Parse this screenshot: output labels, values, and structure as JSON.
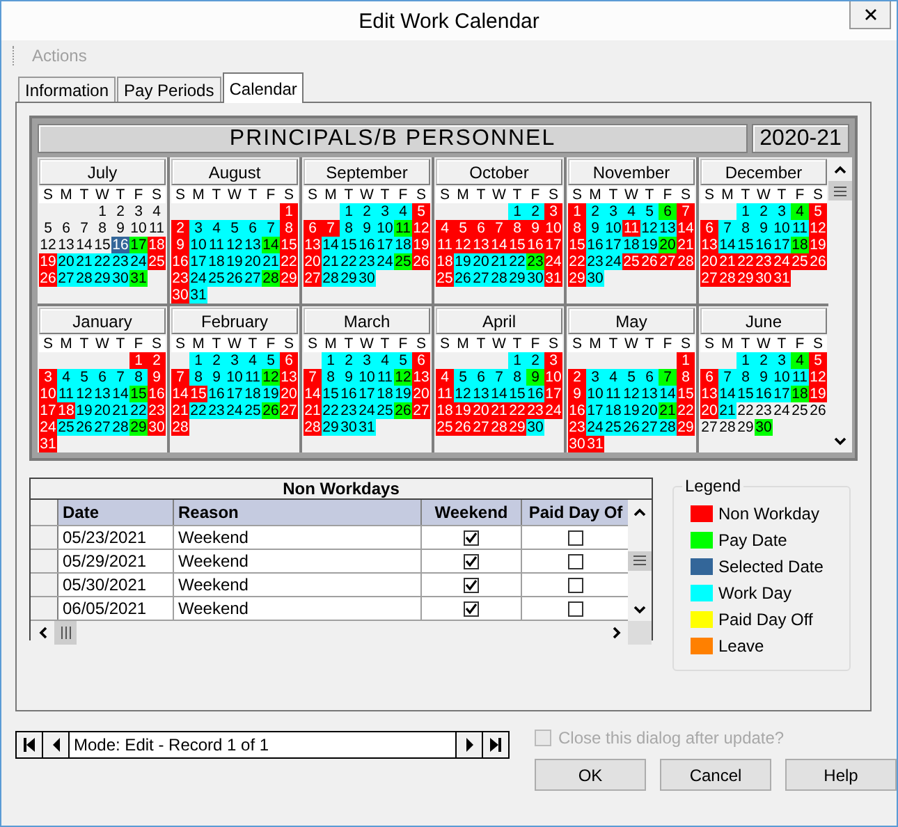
{
  "window": {
    "title": "Edit Work Calendar"
  },
  "menu": [
    {
      "label": "Actions",
      "disabled": true
    }
  ],
  "tabs": [
    {
      "label": "Information",
      "selected": false
    },
    {
      "label": "Pay Periods",
      "selected": false
    },
    {
      "label": "Calendar",
      "selected": true
    }
  ],
  "calendar": {
    "title": "PRINCIPALS/B PERSONNEL",
    "year": "2020-21",
    "months": [
      {
        "name": "July",
        "weekdays": [
          "S",
          "M",
          "T",
          "W",
          "T",
          "F",
          "S"
        ],
        "days": [
          {
            "day": "1",
            "kind": "none"
          },
          {
            "day": "2",
            "kind": "none"
          },
          {
            "day": "3",
            "kind": "none"
          },
          {
            "day": "4",
            "kind": "none"
          },
          {
            "day": "5",
            "kind": "none"
          },
          {
            "day": "6",
            "kind": "none"
          },
          {
            "day": "7",
            "kind": "none"
          },
          {
            "day": "8",
            "kind": "none"
          },
          {
            "day": "9",
            "kind": "none"
          },
          {
            "day": "10",
            "kind": "none"
          },
          {
            "day": "11",
            "kind": "none"
          },
          {
            "day": "12",
            "kind": "none"
          },
          {
            "day": "13",
            "kind": "none"
          },
          {
            "day": "14",
            "kind": "none"
          },
          {
            "day": "15",
            "kind": "none"
          },
          {
            "day": "16",
            "kind": "selected"
          },
          {
            "day": "17",
            "kind": "pay"
          },
          {
            "day": "18",
            "kind": "off"
          },
          {
            "day": "19",
            "kind": "off"
          },
          {
            "day": "20",
            "kind": "work"
          },
          {
            "day": "21",
            "kind": "work"
          },
          {
            "day": "22",
            "kind": "work"
          },
          {
            "day": "23",
            "kind": "work"
          },
          {
            "day": "24",
            "kind": "work"
          },
          {
            "day": "25",
            "kind": "off"
          },
          {
            "day": "26",
            "kind": "off"
          },
          {
            "day": "27",
            "kind": "work"
          },
          {
            "day": "28",
            "kind": "work"
          },
          {
            "day": "29",
            "kind": "work"
          },
          {
            "day": "30",
            "kind": "work"
          },
          {
            "day": "31",
            "kind": "pay"
          }
        ]
      },
      {
        "name": "August",
        "weekdays": [
          "S",
          "M",
          "T",
          "W",
          "T",
          "F",
          "S"
        ],
        "days": [
          {
            "day": "1",
            "kind": "off"
          },
          {
            "day": "2",
            "kind": "off"
          },
          {
            "day": "3",
            "kind": "work"
          },
          {
            "day": "4",
            "kind": "work"
          },
          {
            "day": "5",
            "kind": "work"
          },
          {
            "day": "6",
            "kind": "work"
          },
          {
            "day": "7",
            "kind": "work"
          },
          {
            "day": "8",
            "kind": "off"
          },
          {
            "day": "9",
            "kind": "off"
          },
          {
            "day": "10",
            "kind": "work"
          },
          {
            "day": "11",
            "kind": "work"
          },
          {
            "day": "12",
            "kind": "work"
          },
          {
            "day": "13",
            "kind": "work"
          },
          {
            "day": "14",
            "kind": "pay"
          },
          {
            "day": "15",
            "kind": "off"
          },
          {
            "day": "16",
            "kind": "off"
          },
          {
            "day": "17",
            "kind": "work"
          },
          {
            "day": "18",
            "kind": "work"
          },
          {
            "day": "19",
            "kind": "work"
          },
          {
            "day": "20",
            "kind": "work"
          },
          {
            "day": "21",
            "kind": "work"
          },
          {
            "day": "22",
            "kind": "off"
          },
          {
            "day": "23",
            "kind": "off"
          },
          {
            "day": "24",
            "kind": "work"
          },
          {
            "day": "25",
            "kind": "work"
          },
          {
            "day": "26",
            "kind": "work"
          },
          {
            "day": "27",
            "kind": "work"
          },
          {
            "day": "28",
            "kind": "pay"
          },
          {
            "day": "29",
            "kind": "off"
          },
          {
            "day": "30",
            "kind": "off"
          },
          {
            "day": "31",
            "kind": "work"
          }
        ]
      },
      {
        "name": "September",
        "weekdays": [
          "S",
          "M",
          "T",
          "W",
          "T",
          "F",
          "S"
        ],
        "days": [
          {
            "day": "1",
            "kind": "work"
          },
          {
            "day": "2",
            "kind": "work"
          },
          {
            "day": "3",
            "kind": "work"
          },
          {
            "day": "4",
            "kind": "work"
          },
          {
            "day": "5",
            "kind": "off"
          },
          {
            "day": "6",
            "kind": "off"
          },
          {
            "day": "7",
            "kind": "off"
          },
          {
            "day": "8",
            "kind": "work"
          },
          {
            "day": "9",
            "kind": "work"
          },
          {
            "day": "10",
            "kind": "work"
          },
          {
            "day": "11",
            "kind": "pay"
          },
          {
            "day": "12",
            "kind": "off"
          },
          {
            "day": "13",
            "kind": "off"
          },
          {
            "day": "14",
            "kind": "work"
          },
          {
            "day": "15",
            "kind": "work"
          },
          {
            "day": "16",
            "kind": "work"
          },
          {
            "day": "17",
            "kind": "work"
          },
          {
            "day": "18",
            "kind": "work"
          },
          {
            "day": "19",
            "kind": "off"
          },
          {
            "day": "20",
            "kind": "off"
          },
          {
            "day": "21",
            "kind": "work"
          },
          {
            "day": "22",
            "kind": "work"
          },
          {
            "day": "23",
            "kind": "work"
          },
          {
            "day": "24",
            "kind": "work"
          },
          {
            "day": "25",
            "kind": "pay"
          },
          {
            "day": "26",
            "kind": "off"
          },
          {
            "day": "27",
            "kind": "off"
          },
          {
            "day": "28",
            "kind": "work"
          },
          {
            "day": "29",
            "kind": "work"
          },
          {
            "day": "30",
            "kind": "work"
          }
        ]
      },
      {
        "name": "October",
        "weekdays": [
          "S",
          "M",
          "T",
          "W",
          "T",
          "F",
          "S"
        ],
        "days": [
          {
            "day": "1",
            "kind": "work"
          },
          {
            "day": "2",
            "kind": "work"
          },
          {
            "day": "3",
            "kind": "off"
          },
          {
            "day": "4",
            "kind": "off"
          },
          {
            "day": "5",
            "kind": "off"
          },
          {
            "day": "6",
            "kind": "off"
          },
          {
            "day": "7",
            "kind": "off"
          },
          {
            "day": "8",
            "kind": "off"
          },
          {
            "day": "9",
            "kind": "off"
          },
          {
            "day": "10",
            "kind": "off"
          },
          {
            "day": "11",
            "kind": "off"
          },
          {
            "day": "12",
            "kind": "off"
          },
          {
            "day": "13",
            "kind": "off"
          },
          {
            "day": "14",
            "kind": "off"
          },
          {
            "day": "15",
            "kind": "off"
          },
          {
            "day": "16",
            "kind": "off"
          },
          {
            "day": "17",
            "kind": "off"
          },
          {
            "day": "18",
            "kind": "off"
          },
          {
            "day": "19",
            "kind": "work"
          },
          {
            "day": "20",
            "kind": "work"
          },
          {
            "day": "21",
            "kind": "work"
          },
          {
            "day": "22",
            "kind": "work"
          },
          {
            "day": "23",
            "kind": "pay"
          },
          {
            "day": "24",
            "kind": "off"
          },
          {
            "day": "25",
            "kind": "off"
          },
          {
            "day": "26",
            "kind": "work"
          },
          {
            "day": "27",
            "kind": "work"
          },
          {
            "day": "28",
            "kind": "work"
          },
          {
            "day": "29",
            "kind": "work"
          },
          {
            "day": "30",
            "kind": "work"
          },
          {
            "day": "31",
            "kind": "off"
          }
        ]
      },
      {
        "name": "November",
        "weekdays": [
          "S",
          "M",
          "T",
          "W",
          "T",
          "F",
          "S"
        ],
        "days": [
          {
            "day": "1",
            "kind": "off"
          },
          {
            "day": "2",
            "kind": "work"
          },
          {
            "day": "3",
            "kind": "work"
          },
          {
            "day": "4",
            "kind": "work"
          },
          {
            "day": "5",
            "kind": "work"
          },
          {
            "day": "6",
            "kind": "pay"
          },
          {
            "day": "7",
            "kind": "off"
          },
          {
            "day": "8",
            "kind": "off"
          },
          {
            "day": "9",
            "kind": "work"
          },
          {
            "day": "10",
            "kind": "work"
          },
          {
            "day": "11",
            "kind": "off"
          },
          {
            "day": "12",
            "kind": "work"
          },
          {
            "day": "13",
            "kind": "work"
          },
          {
            "day": "14",
            "kind": "off"
          },
          {
            "day": "15",
            "kind": "off"
          },
          {
            "day": "16",
            "kind": "work"
          },
          {
            "day": "17",
            "kind": "work"
          },
          {
            "day": "18",
            "kind": "work"
          },
          {
            "day": "19",
            "kind": "work"
          },
          {
            "day": "20",
            "kind": "pay"
          },
          {
            "day": "21",
            "kind": "off"
          },
          {
            "day": "22",
            "kind": "off"
          },
          {
            "day": "23",
            "kind": "work"
          },
          {
            "day": "24",
            "kind": "work"
          },
          {
            "day": "25",
            "kind": "off"
          },
          {
            "day": "26",
            "kind": "off"
          },
          {
            "day": "27",
            "kind": "off"
          },
          {
            "day": "28",
            "kind": "off"
          },
          {
            "day": "29",
            "kind": "off"
          },
          {
            "day": "30",
            "kind": "work"
          }
        ]
      },
      {
        "name": "December",
        "weekdays": [
          "S",
          "M",
          "T",
          "W",
          "T",
          "F",
          "S"
        ],
        "days": [
          {
            "day": "1",
            "kind": "work"
          },
          {
            "day": "2",
            "kind": "work"
          },
          {
            "day": "3",
            "kind": "work"
          },
          {
            "day": "4",
            "kind": "pay"
          },
          {
            "day": "5",
            "kind": "off"
          },
          {
            "day": "6",
            "kind": "off"
          },
          {
            "day": "7",
            "kind": "work"
          },
          {
            "day": "8",
            "kind": "work"
          },
          {
            "day": "9",
            "kind": "work"
          },
          {
            "day": "10",
            "kind": "work"
          },
          {
            "day": "11",
            "kind": "work"
          },
          {
            "day": "12",
            "kind": "off"
          },
          {
            "day": "13",
            "kind": "off"
          },
          {
            "day": "14",
            "kind": "work"
          },
          {
            "day": "15",
            "kind": "work"
          },
          {
            "day": "16",
            "kind": "work"
          },
          {
            "day": "17",
            "kind": "work"
          },
          {
            "day": "18",
            "kind": "pay"
          },
          {
            "day": "19",
            "kind": "off"
          },
          {
            "day": "20",
            "kind": "off"
          },
          {
            "day": "21",
            "kind": "off"
          },
          {
            "day": "22",
            "kind": "off"
          },
          {
            "day": "23",
            "kind": "off"
          },
          {
            "day": "24",
            "kind": "off"
          },
          {
            "day": "25",
            "kind": "off"
          },
          {
            "day": "26",
            "kind": "off"
          },
          {
            "day": "27",
            "kind": "off"
          },
          {
            "day": "28",
            "kind": "off"
          },
          {
            "day": "29",
            "kind": "off"
          },
          {
            "day": "30",
            "kind": "off"
          },
          {
            "day": "31",
            "kind": "off"
          }
        ]
      },
      {
        "name": "January",
        "weekdays": [
          "S",
          "M",
          "T",
          "W",
          "T",
          "F",
          "S"
        ],
        "days": [
          {
            "day": "1",
            "kind": "off"
          },
          {
            "day": "2",
            "kind": "off"
          },
          {
            "day": "3",
            "kind": "off"
          },
          {
            "day": "4",
            "kind": "work"
          },
          {
            "day": "5",
            "kind": "work"
          },
          {
            "day": "6",
            "kind": "work"
          },
          {
            "day": "7",
            "kind": "work"
          },
          {
            "day": "8",
            "kind": "work"
          },
          {
            "day": "9",
            "kind": "off"
          },
          {
            "day": "10",
            "kind": "off"
          },
          {
            "day": "11",
            "kind": "work"
          },
          {
            "day": "12",
            "kind": "work"
          },
          {
            "day": "13",
            "kind": "work"
          },
          {
            "day": "14",
            "kind": "work"
          },
          {
            "day": "15",
            "kind": "pay"
          },
          {
            "day": "16",
            "kind": "off"
          },
          {
            "day": "17",
            "kind": "off"
          },
          {
            "day": "18",
            "kind": "off"
          },
          {
            "day": "19",
            "kind": "work"
          },
          {
            "day": "20",
            "kind": "work"
          },
          {
            "day": "21",
            "kind": "work"
          },
          {
            "day": "22",
            "kind": "work"
          },
          {
            "day": "23",
            "kind": "off"
          },
          {
            "day": "24",
            "kind": "off"
          },
          {
            "day": "25",
            "kind": "work"
          },
          {
            "day": "26",
            "kind": "work"
          },
          {
            "day": "27",
            "kind": "work"
          },
          {
            "day": "28",
            "kind": "work"
          },
          {
            "day": "29",
            "kind": "pay"
          },
          {
            "day": "30",
            "kind": "off"
          },
          {
            "day": "31",
            "kind": "off"
          }
        ]
      },
      {
        "name": "February",
        "weekdays": [
          "S",
          "M",
          "T",
          "W",
          "T",
          "F",
          "S"
        ],
        "days": [
          {
            "day": "1",
            "kind": "work"
          },
          {
            "day": "2",
            "kind": "work"
          },
          {
            "day": "3",
            "kind": "work"
          },
          {
            "day": "4",
            "kind": "work"
          },
          {
            "day": "5",
            "kind": "work"
          },
          {
            "day": "6",
            "kind": "off"
          },
          {
            "day": "7",
            "kind": "off"
          },
          {
            "day": "8",
            "kind": "work"
          },
          {
            "day": "9",
            "kind": "work"
          },
          {
            "day": "10",
            "kind": "work"
          },
          {
            "day": "11",
            "kind": "work"
          },
          {
            "day": "12",
            "kind": "pay"
          },
          {
            "day": "13",
            "kind": "off"
          },
          {
            "day": "14",
            "kind": "off"
          },
          {
            "day": "15",
            "kind": "off"
          },
          {
            "day": "16",
            "kind": "work"
          },
          {
            "day": "17",
            "kind": "work"
          },
          {
            "day": "18",
            "kind": "work"
          },
          {
            "day": "19",
            "kind": "work"
          },
          {
            "day": "20",
            "kind": "off"
          },
          {
            "day": "21",
            "kind": "off"
          },
          {
            "day": "22",
            "kind": "work"
          },
          {
            "day": "23",
            "kind": "work"
          },
          {
            "day": "24",
            "kind": "work"
          },
          {
            "day": "25",
            "kind": "work"
          },
          {
            "day": "26",
            "kind": "pay"
          },
          {
            "day": "27",
            "kind": "off"
          },
          {
            "day": "28",
            "kind": "off"
          }
        ]
      },
      {
        "name": "March",
        "weekdays": [
          "S",
          "M",
          "T",
          "W",
          "T",
          "F",
          "S"
        ],
        "days": [
          {
            "day": "1",
            "kind": "work"
          },
          {
            "day": "2",
            "kind": "work"
          },
          {
            "day": "3",
            "kind": "work"
          },
          {
            "day": "4",
            "kind": "work"
          },
          {
            "day": "5",
            "kind": "work"
          },
          {
            "day": "6",
            "kind": "off"
          },
          {
            "day": "7",
            "kind": "off"
          },
          {
            "day": "8",
            "kind": "work"
          },
          {
            "day": "9",
            "kind": "work"
          },
          {
            "day": "10",
            "kind": "work"
          },
          {
            "day": "11",
            "kind": "work"
          },
          {
            "day": "12",
            "kind": "pay"
          },
          {
            "day": "13",
            "kind": "off"
          },
          {
            "day": "14",
            "kind": "off"
          },
          {
            "day": "15",
            "kind": "work"
          },
          {
            "day": "16",
            "kind": "work"
          },
          {
            "day": "17",
            "kind": "work"
          },
          {
            "day": "18",
            "kind": "work"
          },
          {
            "day": "19",
            "kind": "work"
          },
          {
            "day": "20",
            "kind": "off"
          },
          {
            "day": "21",
            "kind": "off"
          },
          {
            "day": "22",
            "kind": "work"
          },
          {
            "day": "23",
            "kind": "work"
          },
          {
            "day": "24",
            "kind": "work"
          },
          {
            "day": "25",
            "kind": "work"
          },
          {
            "day": "26",
            "kind": "pay"
          },
          {
            "day": "27",
            "kind": "off"
          },
          {
            "day": "28",
            "kind": "off"
          },
          {
            "day": "29",
            "kind": "work"
          },
          {
            "day": "30",
            "kind": "work"
          },
          {
            "day": "31",
            "kind": "work"
          }
        ]
      },
      {
        "name": "April",
        "weekdays": [
          "S",
          "M",
          "T",
          "W",
          "T",
          "F",
          "S"
        ],
        "days": [
          {
            "day": "1",
            "kind": "work"
          },
          {
            "day": "2",
            "kind": "work"
          },
          {
            "day": "3",
            "kind": "off"
          },
          {
            "day": "4",
            "kind": "off"
          },
          {
            "day": "5",
            "kind": "work"
          },
          {
            "day": "6",
            "kind": "work"
          },
          {
            "day": "7",
            "kind": "work"
          },
          {
            "day": "8",
            "kind": "work"
          },
          {
            "day": "9",
            "kind": "pay"
          },
          {
            "day": "10",
            "kind": "off"
          },
          {
            "day": "11",
            "kind": "off"
          },
          {
            "day": "12",
            "kind": "work"
          },
          {
            "day": "13",
            "kind": "work"
          },
          {
            "day": "14",
            "kind": "work"
          },
          {
            "day": "15",
            "kind": "work"
          },
          {
            "day": "16",
            "kind": "work"
          },
          {
            "day": "17",
            "kind": "off"
          },
          {
            "day": "18",
            "kind": "off"
          },
          {
            "day": "19",
            "kind": "off"
          },
          {
            "day": "20",
            "kind": "off"
          },
          {
            "day": "21",
            "kind": "off"
          },
          {
            "day": "22",
            "kind": "off"
          },
          {
            "day": "23",
            "kind": "off"
          },
          {
            "day": "24",
            "kind": "off"
          },
          {
            "day": "25",
            "kind": "off"
          },
          {
            "day": "26",
            "kind": "off"
          },
          {
            "day": "27",
            "kind": "off"
          },
          {
            "day": "28",
            "kind": "off"
          },
          {
            "day": "29",
            "kind": "off"
          },
          {
            "day": "30",
            "kind": "work"
          }
        ]
      },
      {
        "name": "May",
        "weekdays": [
          "S",
          "M",
          "T",
          "W",
          "T",
          "F",
          "S"
        ],
        "days": [
          {
            "day": "1",
            "kind": "off"
          },
          {
            "day": "2",
            "kind": "off"
          },
          {
            "day": "3",
            "kind": "work"
          },
          {
            "day": "4",
            "kind": "work"
          },
          {
            "day": "5",
            "kind": "work"
          },
          {
            "day": "6",
            "kind": "work"
          },
          {
            "day": "7",
            "kind": "pay"
          },
          {
            "day": "8",
            "kind": "off"
          },
          {
            "day": "9",
            "kind": "off"
          },
          {
            "day": "10",
            "kind": "work"
          },
          {
            "day": "11",
            "kind": "work"
          },
          {
            "day": "12",
            "kind": "work"
          },
          {
            "day": "13",
            "kind": "work"
          },
          {
            "day": "14",
            "kind": "work"
          },
          {
            "day": "15",
            "kind": "off"
          },
          {
            "day": "16",
            "kind": "off"
          },
          {
            "day": "17",
            "kind": "work"
          },
          {
            "day": "18",
            "kind": "work"
          },
          {
            "day": "19",
            "kind": "work"
          },
          {
            "day": "20",
            "kind": "work"
          },
          {
            "day": "21",
            "kind": "pay"
          },
          {
            "day": "22",
            "kind": "off"
          },
          {
            "day": "23",
            "kind": "off"
          },
          {
            "day": "24",
            "kind": "work"
          },
          {
            "day": "25",
            "kind": "work"
          },
          {
            "day": "26",
            "kind": "work"
          },
          {
            "day": "27",
            "kind": "work"
          },
          {
            "day": "28",
            "kind": "work"
          },
          {
            "day": "29",
            "kind": "off"
          },
          {
            "day": "30",
            "kind": "off"
          },
          {
            "day": "31",
            "kind": "off"
          }
        ]
      },
      {
        "name": "June",
        "weekdays": [
          "S",
          "M",
          "T",
          "W",
          "T",
          "F",
          "S"
        ],
        "days": [
          {
            "day": "1",
            "kind": "work"
          },
          {
            "day": "2",
            "kind": "work"
          },
          {
            "day": "3",
            "kind": "work"
          },
          {
            "day": "4",
            "kind": "pay"
          },
          {
            "day": "5",
            "kind": "off"
          },
          {
            "day": "6",
            "kind": "off"
          },
          {
            "day": "7",
            "kind": "work"
          },
          {
            "day": "8",
            "kind": "work"
          },
          {
            "day": "9",
            "kind": "work"
          },
          {
            "day": "10",
            "kind": "work"
          },
          {
            "day": "11",
            "kind": "work"
          },
          {
            "day": "12",
            "kind": "off"
          },
          {
            "day": "13",
            "kind": "off"
          },
          {
            "day": "14",
            "kind": "work"
          },
          {
            "day": "15",
            "kind": "work"
          },
          {
            "day": "16",
            "kind": "work"
          },
          {
            "day": "17",
            "kind": "work"
          },
          {
            "day": "18",
            "kind": "pay"
          },
          {
            "day": "19",
            "kind": "off"
          },
          {
            "day": "20",
            "kind": "off"
          },
          {
            "day": "21",
            "kind": "work"
          },
          {
            "day": "22",
            "kind": "none"
          },
          {
            "day": "23",
            "kind": "none"
          },
          {
            "day": "24",
            "kind": "none"
          },
          {
            "day": "25",
            "kind": "none"
          },
          {
            "day": "26",
            "kind": "none"
          },
          {
            "day": "27",
            "kind": "none"
          },
          {
            "day": "28",
            "kind": "none"
          },
          {
            "day": "29",
            "kind": "none"
          },
          {
            "day": "30",
            "kind": "pay"
          }
        ]
      }
    ]
  },
  "non_workdays": {
    "title": "Non Workdays",
    "columns": [
      "Date",
      "Reason",
      "Weekend",
      "Paid Day Of"
    ],
    "rows": [
      {
        "date": "05/23/2021",
        "reason": "Weekend",
        "weekend": true,
        "paid_day_off": false
      },
      {
        "date": "05/29/2021",
        "reason": "Weekend",
        "weekend": true,
        "paid_day_off": false
      },
      {
        "date": "05/30/2021",
        "reason": "Weekend",
        "weekend": true,
        "paid_day_off": false
      },
      {
        "date": "06/05/2021",
        "reason": "Weekend",
        "weekend": true,
        "paid_day_off": false
      }
    ]
  },
  "legend": {
    "title": "Legend",
    "items": [
      {
        "label": "Non Workday",
        "color": "#ff0000"
      },
      {
        "label": "Pay Date",
        "color": "#00ff00"
      },
      {
        "label": "Selected Date",
        "color": "#336699"
      },
      {
        "label": "Work Day",
        "color": "#00ffff"
      },
      {
        "label": "Paid Day Off",
        "color": "#ffff00"
      },
      {
        "label": "Leave",
        "color": "#ff8000"
      }
    ]
  },
  "navigator": {
    "status": "Mode: Edit - Record 1 of 1"
  },
  "close_after_update": {
    "label": "Close this dialog after update?",
    "checked": false,
    "disabled": true
  },
  "buttons": [
    "OK",
    "Cancel",
    "Help"
  ]
}
